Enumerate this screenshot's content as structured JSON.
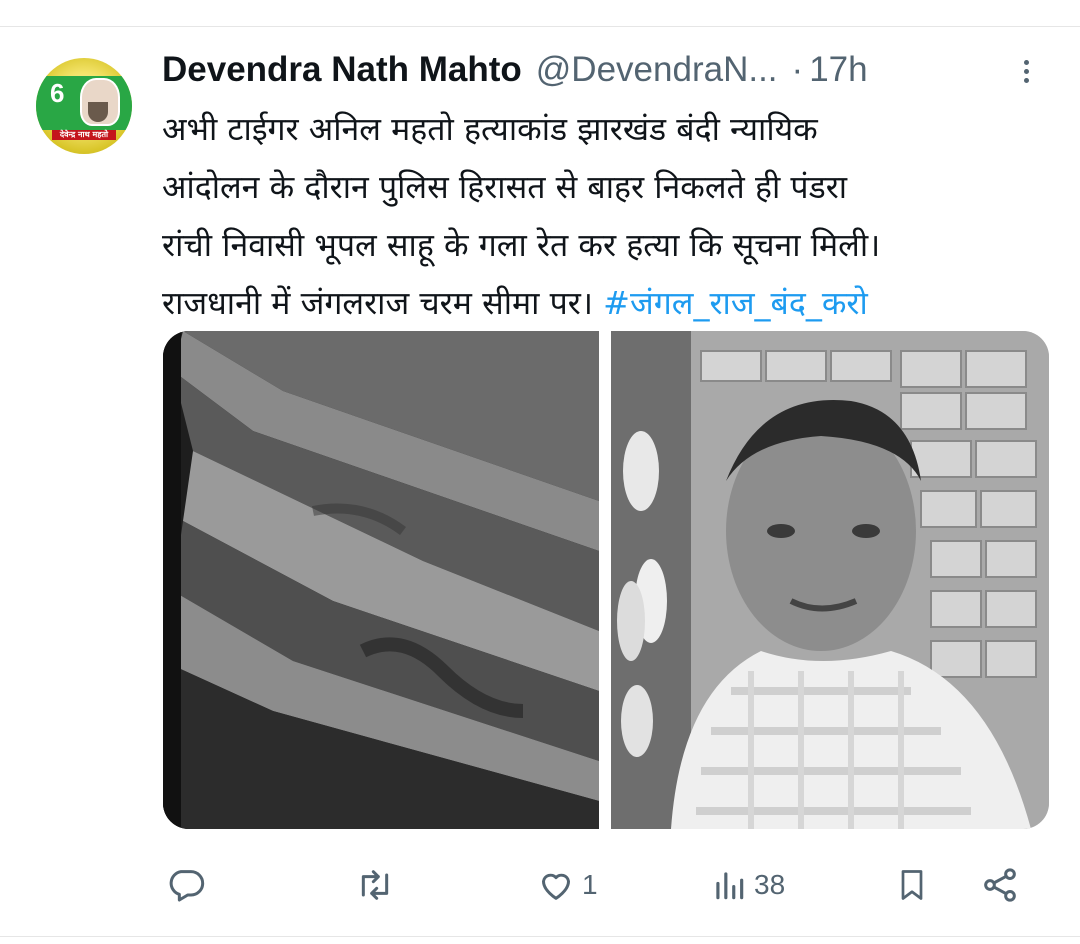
{
  "author": {
    "name": "Devendra Nath Mahto",
    "handle": "@DevendraN...",
    "separator": "·",
    "time": "17h",
    "avatar_text": "देवेन्द्र नाथ महतो",
    "avatar_number": "6"
  },
  "tweet": {
    "lines": [
      "अभी टाईगर अनिल महतो हत्याकांड झारखंड बंदी न्यायिक",
      "आंदोलन के दौरान पुलिस हिरासत से बाहर निकलते ही पंडरा",
      "रांची निवासी भूपल साहू के गला रेत कर हत्या कि सूचना मिली।",
      "राजधानी में जंगलराज चरम सीमा पर।"
    ],
    "hashtag": "#जंगल_राज_बंद_करो"
  },
  "actions": {
    "reply_count": "",
    "retweet_count": "",
    "like_count": "1",
    "views_count": "38"
  },
  "colors": {
    "text": "#0f1419",
    "secondary": "#536471",
    "link": "#1d9bf0"
  },
  "icons": [
    "reply-icon",
    "retweet-icon",
    "like-icon",
    "views-icon",
    "bookmark-icon",
    "share-icon",
    "more-icon"
  ]
}
